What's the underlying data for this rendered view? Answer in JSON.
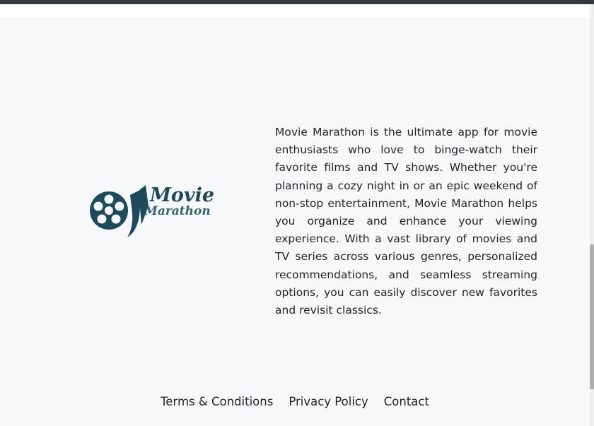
{
  "brand": {
    "logo_line1": "Movie",
    "logo_line2": "Marathon",
    "logo_color": "#1c4b5b",
    "icon": "film-reel-icon"
  },
  "about": {
    "text": "Movie Marathon is the ultimate app for movie enthusiasts who love to binge-watch their favorite films and TV shows. Whether you're planning a cozy night in or an epic weekend of non-stop entertainment, Movie Marathon helps you organize and enhance your viewing experience. With a vast library of movies and TV series across various genres, personalized recommendations, and seamless streaming options, you can easily discover new favorites and revisit classics."
  },
  "footer": {
    "links": [
      "Terms & Conditions",
      "Privacy Policy",
      "Contact"
    ]
  }
}
